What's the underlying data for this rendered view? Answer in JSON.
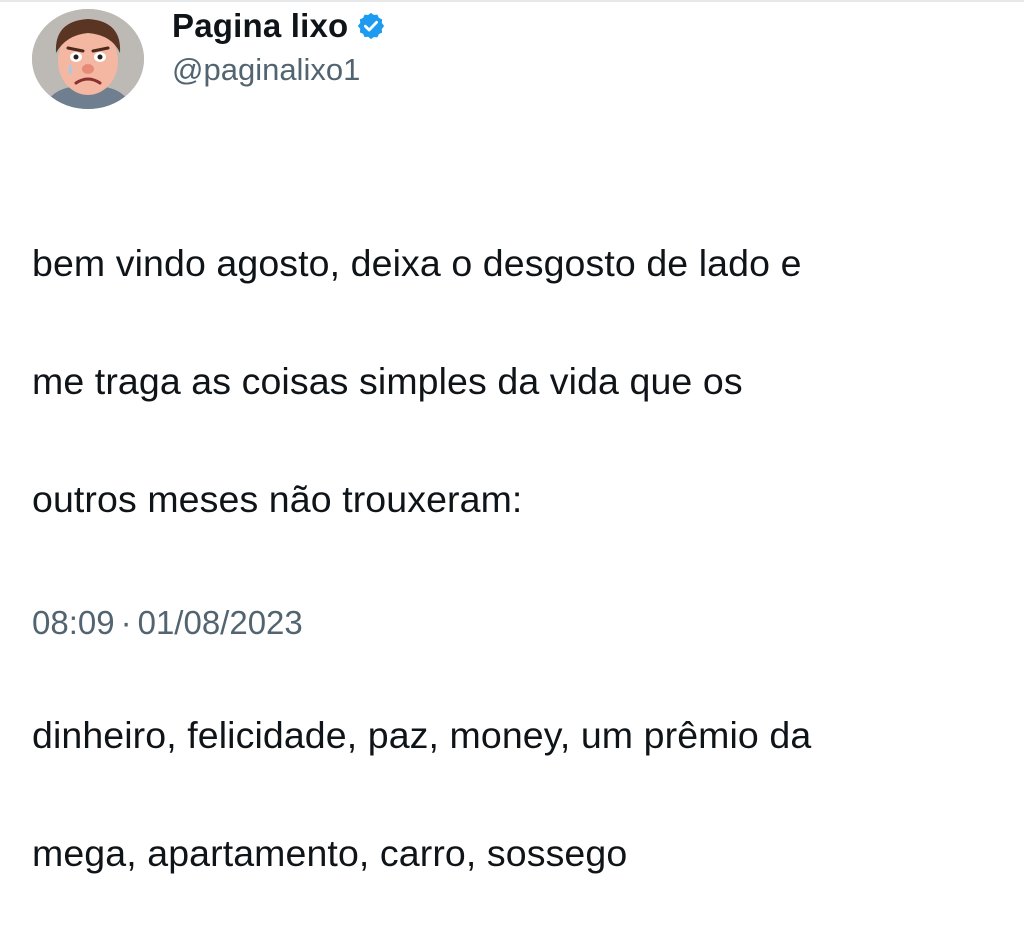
{
  "tweet": {
    "author": {
      "display_name": "Pagina lixo",
      "handle": "@paginalixo1",
      "verified": true,
      "avatar_icon": "cartoon-face-avatar"
    },
    "text_lines": [
      "bem vindo agosto, deixa o desgosto de lado e",
      "me traga as coisas simples da vida que os",
      "outros meses não trouxeram:",
      "",
      "dinheiro, felicidade, paz, money, um prêmio da",
      "mega, apartamento, carro, sossego"
    ],
    "time": "08:09",
    "separator": "·",
    "date": "01/08/2023"
  },
  "colors": {
    "verified_badge": "#1d9bf0",
    "text": "#0f1419",
    "secondary_text": "#536471"
  }
}
